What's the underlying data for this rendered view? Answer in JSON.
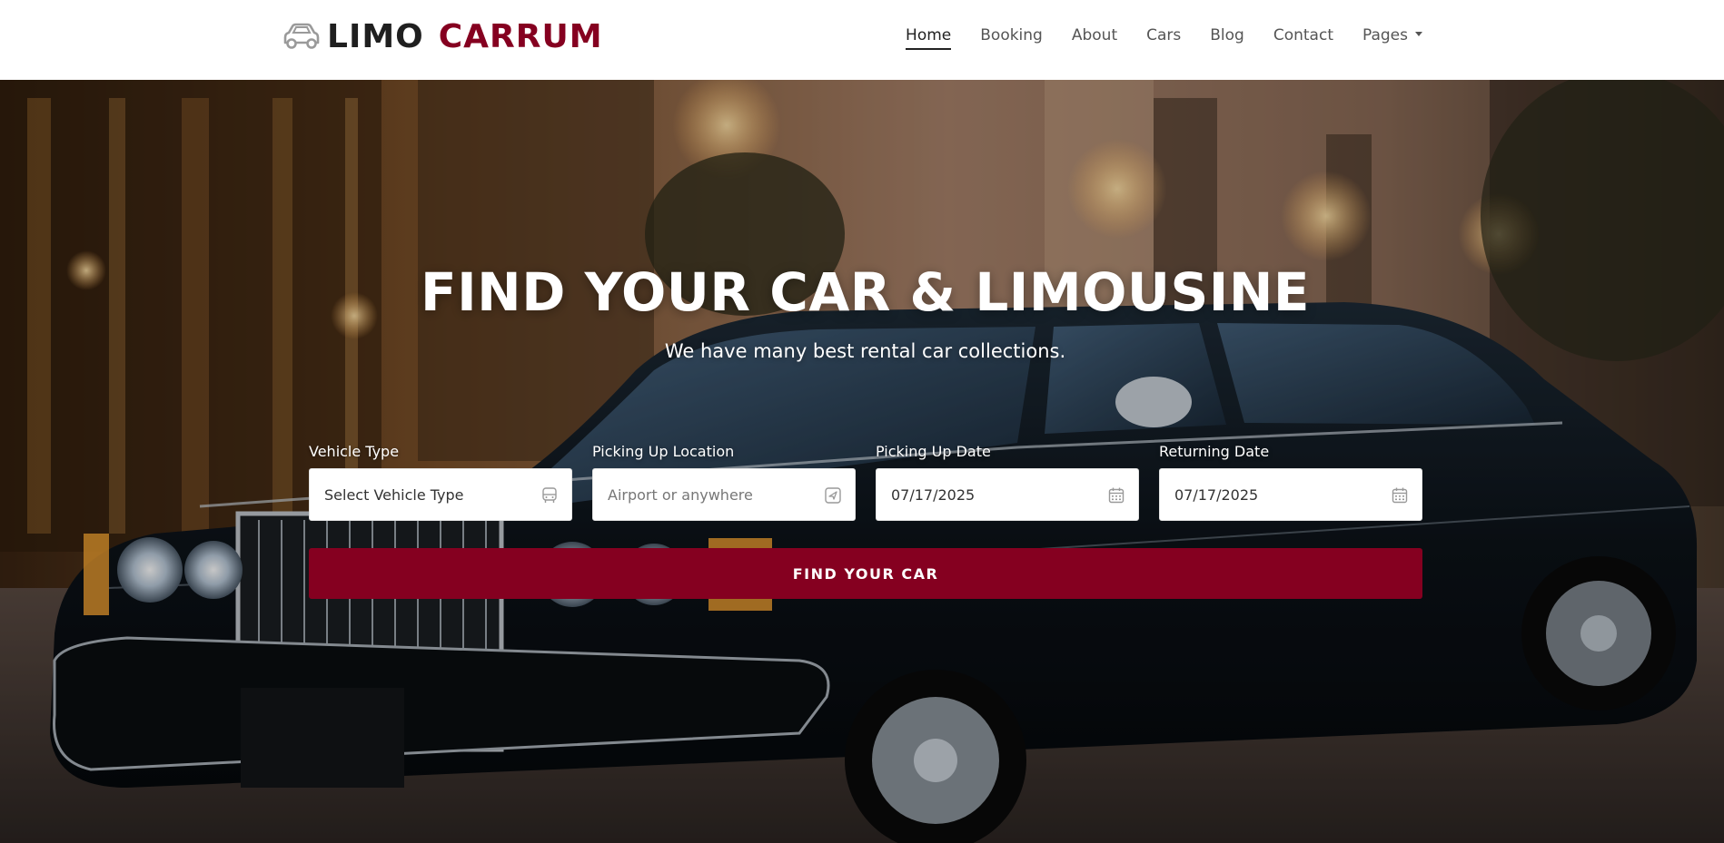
{
  "brand": {
    "word1": "LIMO",
    "word2": "CARRUM",
    "icon": "car-icon",
    "accent_color": "#850020"
  },
  "nav": {
    "items": [
      {
        "label": "Home",
        "active": true
      },
      {
        "label": "Booking",
        "active": false
      },
      {
        "label": "About",
        "active": false
      },
      {
        "label": "Cars",
        "active": false
      },
      {
        "label": "Blog",
        "active": false
      },
      {
        "label": "Contact",
        "active": false
      },
      {
        "label": "Pages",
        "active": false,
        "dropdown": true
      }
    ]
  },
  "hero": {
    "title": "FIND YOUR CAR & LIMOUSINE",
    "subtitle": "We have many best rental car collections.",
    "background": "black-limousine-photo"
  },
  "search_form": {
    "vehicle_type": {
      "label": "Vehicle Type",
      "value": "Select Vehicle Type",
      "icon": "bus-icon"
    },
    "pickup_location": {
      "label": "Picking Up Location",
      "placeholder": "Airport or anywhere",
      "icon": "send-icon"
    },
    "pickup_date": {
      "label": "Picking Up Date",
      "value": "07/17/2025",
      "icon": "calendar-icon"
    },
    "return_date": {
      "label": "Returning Date",
      "value": "07/17/2025",
      "icon": "calendar-icon"
    },
    "submit_label": "FIND YOUR CAR",
    "button_color": "#850020"
  }
}
